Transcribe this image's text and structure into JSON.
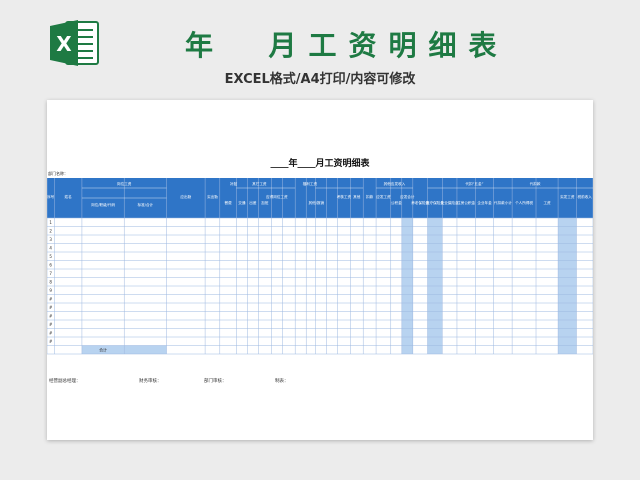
{
  "header": {
    "main_title": "年  月工资明细表",
    "subtitle": "EXCEL格式/A4打印/内容可修改",
    "logo_letter": "X",
    "brand_color": "#1e7a43"
  },
  "sheet": {
    "title": "____年____月工资明细表",
    "dept_label": "部门名称：",
    "header_bg": "#2f75c7",
    "highlight_col_bg": "#b8d3f0",
    "grid_color": "#9db8e0",
    "col_headers": [
      {
        "label": "序号",
        "rows": "all"
      },
      {
        "label": "姓名",
        "rows": "all"
      },
      {
        "label": "岗位工资",
        "group": true
      },
      {
        "label": "岗位/职级/代码",
        "sub": true
      },
      {
        "label": "标准/合计",
        "sub": true
      },
      {
        "label": "应出勤",
        "rows": "all"
      },
      {
        "label": "实出勤",
        "rows": "all"
      },
      {
        "label": "补贴",
        "group": true
      },
      {
        "label": "餐费",
        "sub": true
      },
      {
        "label": "交通",
        "sub": true
      },
      {
        "label": "其它工资",
        "group": true
      },
      {
        "label": "出差",
        "sub": true
      },
      {
        "label": "加班",
        "sub": true
      },
      {
        "label": "应得岗位工资",
        "rows": "all"
      },
      {
        "label": "福利工资",
        "group": true
      },
      {
        "label": "其他/报销",
        "sub": true
      },
      {
        "label": "考核工资",
        "rows": "all"
      },
      {
        "label": "其他",
        "rows": "all"
      },
      {
        "label": "扣款",
        "rows": "all"
      },
      {
        "label": "其他应发收入",
        "group": true
      },
      {
        "label": "应发工资",
        "rows": "all"
      },
      {
        "label": "公积金",
        "sub": true
      },
      {
        "label": "应发合计",
        "rows": "all"
      },
      {
        "label": "代扣“五金”",
        "group": true
      },
      {
        "label": "养老保险金",
        "sub": true
      },
      {
        "label": "医疗保险金",
        "sub": true
      },
      {
        "label": "失业保险金",
        "sub": true
      },
      {
        "label": "住房公积金",
        "sub": true
      },
      {
        "label": "企业年金",
        "sub": true
      },
      {
        "label": "代扣款小计",
        "sub": true
      },
      {
        "label": "代扣款",
        "group": true
      },
      {
        "label": "个人所得税",
        "sub": true
      },
      {
        "label": "工资",
        "sub": true
      },
      {
        "label": "实发工资",
        "rows": "all"
      },
      {
        "label": "税前收入",
        "rows": "all"
      }
    ],
    "row_numbers": [
      "1",
      "2",
      "3",
      "4",
      "5",
      "6",
      "7",
      "8",
      "9",
      "#",
      "#",
      "#",
      "#",
      "#",
      "#"
    ],
    "total_label": "合计"
  },
  "footer": {
    "manager": "经营副总经理：",
    "finance": "财务审核：",
    "dept_review": "部门审核：",
    "preparer": "制表："
  }
}
